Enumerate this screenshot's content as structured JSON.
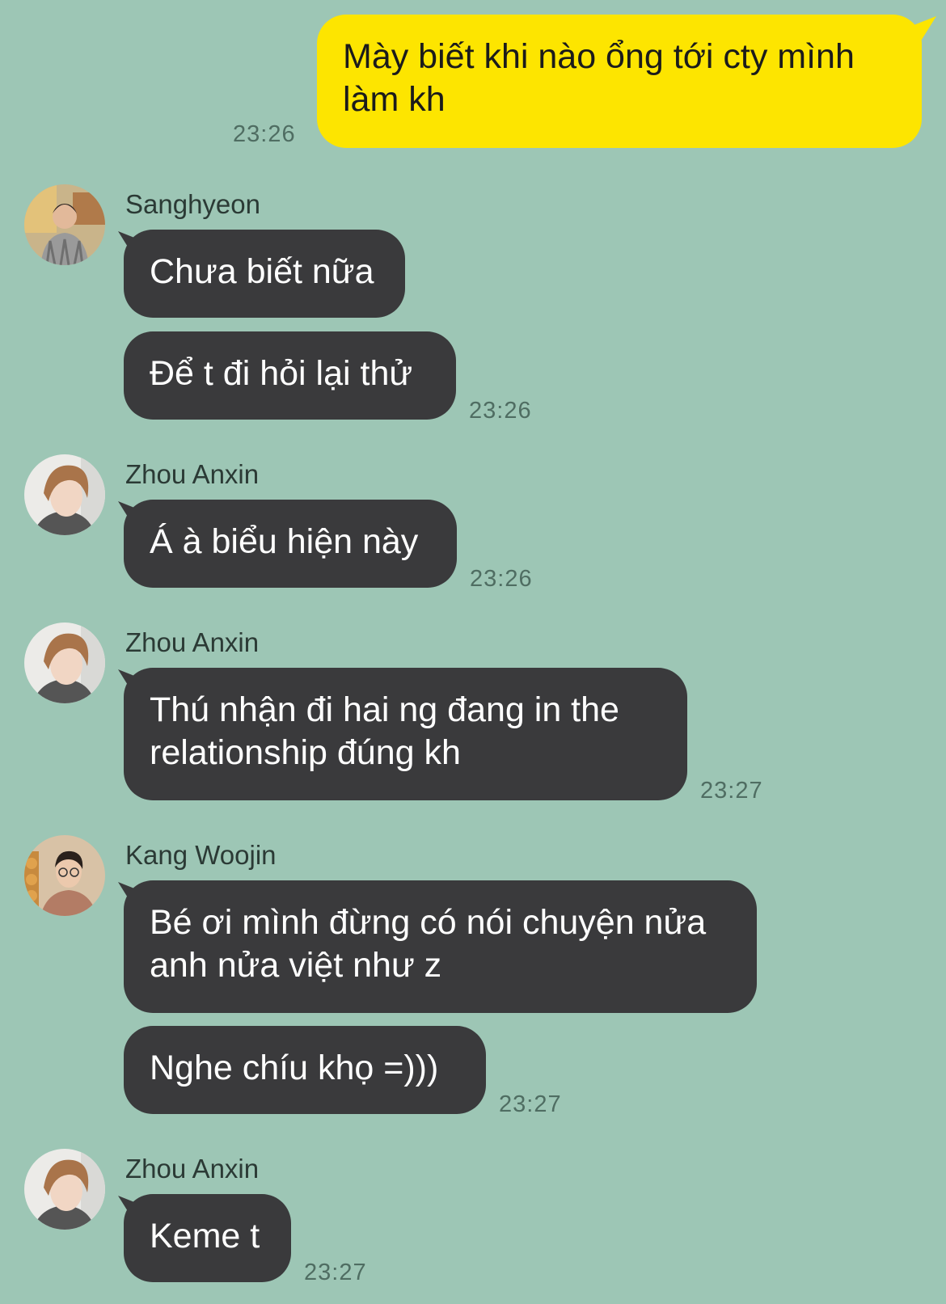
{
  "chat": {
    "outgoing": [
      {
        "text": "Mày biết khi nào ổng tới cty mình\nlàm kh",
        "time": "23:26"
      }
    ],
    "groups": [
      {
        "sender": "Sanghyeon",
        "messages": [
          "Chưa biết nữa",
          "Để t đi hỏi lại thử"
        ],
        "time": "23:26"
      },
      {
        "sender": "Zhou Anxin",
        "messages": [
          "Á à biểu hiện này"
        ],
        "time": "23:26"
      },
      {
        "sender": "Zhou Anxin",
        "messages": [
          "Thú nhận đi hai ng đang in the\nrelationship đúng kh"
        ],
        "time": "23:27"
      },
      {
        "sender": "Kang Woojin",
        "messages": [
          "Bé ơi mình đừng có nói chuyện nửa\nanh nửa việt như z",
          "Nghe chíu khọ =)))"
        ],
        "time": "23:27"
      },
      {
        "sender": "Zhou Anxin",
        "messages": [
          "Keme t"
        ],
        "time": "23:27"
      }
    ]
  },
  "colors": {
    "background": "#9dc6b5",
    "incoming_bubble": "#3a3a3c",
    "outgoing_bubble": "#fde500"
  },
  "avatars": {
    "sanghyeon": "person-avatar-sanghyeon",
    "zhou_anxin": "person-avatar-zhou-anxin",
    "kang_woojin": "person-avatar-kang-woojin"
  }
}
